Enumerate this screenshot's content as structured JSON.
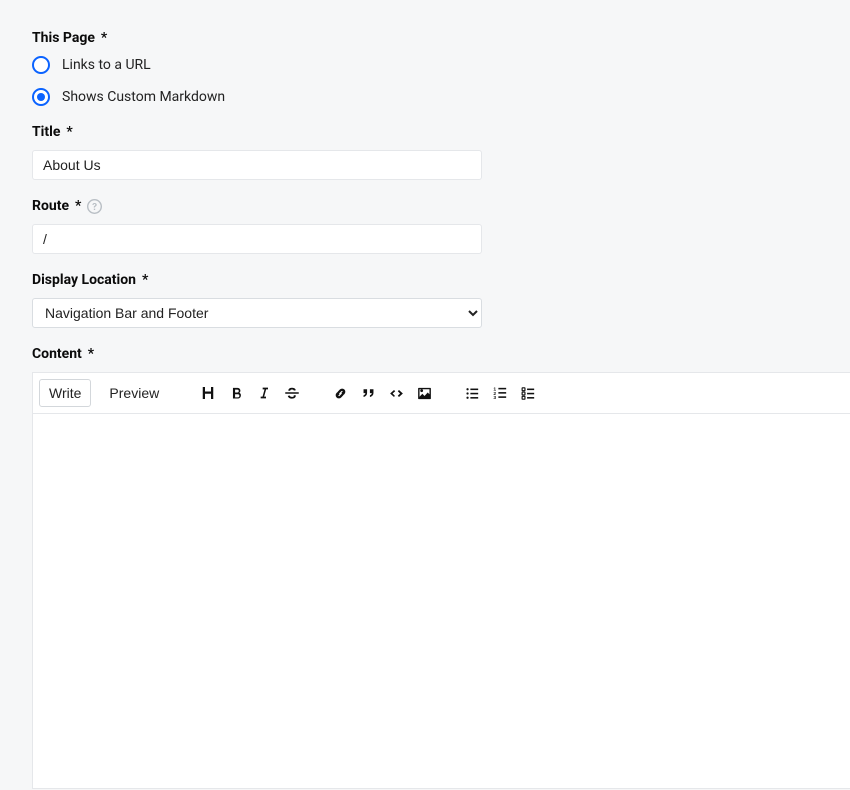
{
  "thisPage": {
    "label": "This Page",
    "required": "*",
    "options": [
      {
        "label": "Links to a URL",
        "checked": false
      },
      {
        "label": "Shows Custom Markdown",
        "checked": true
      }
    ]
  },
  "title": {
    "label": "Title",
    "required": "*",
    "value": "About Us"
  },
  "route": {
    "label": "Route",
    "required": "*",
    "value": "/"
  },
  "displayLocation": {
    "label": "Display Location",
    "required": "*",
    "selected": "Navigation Bar and Footer"
  },
  "content": {
    "label": "Content",
    "required": "*",
    "tabs": {
      "write": "Write",
      "preview": "Preview"
    },
    "body": ""
  }
}
